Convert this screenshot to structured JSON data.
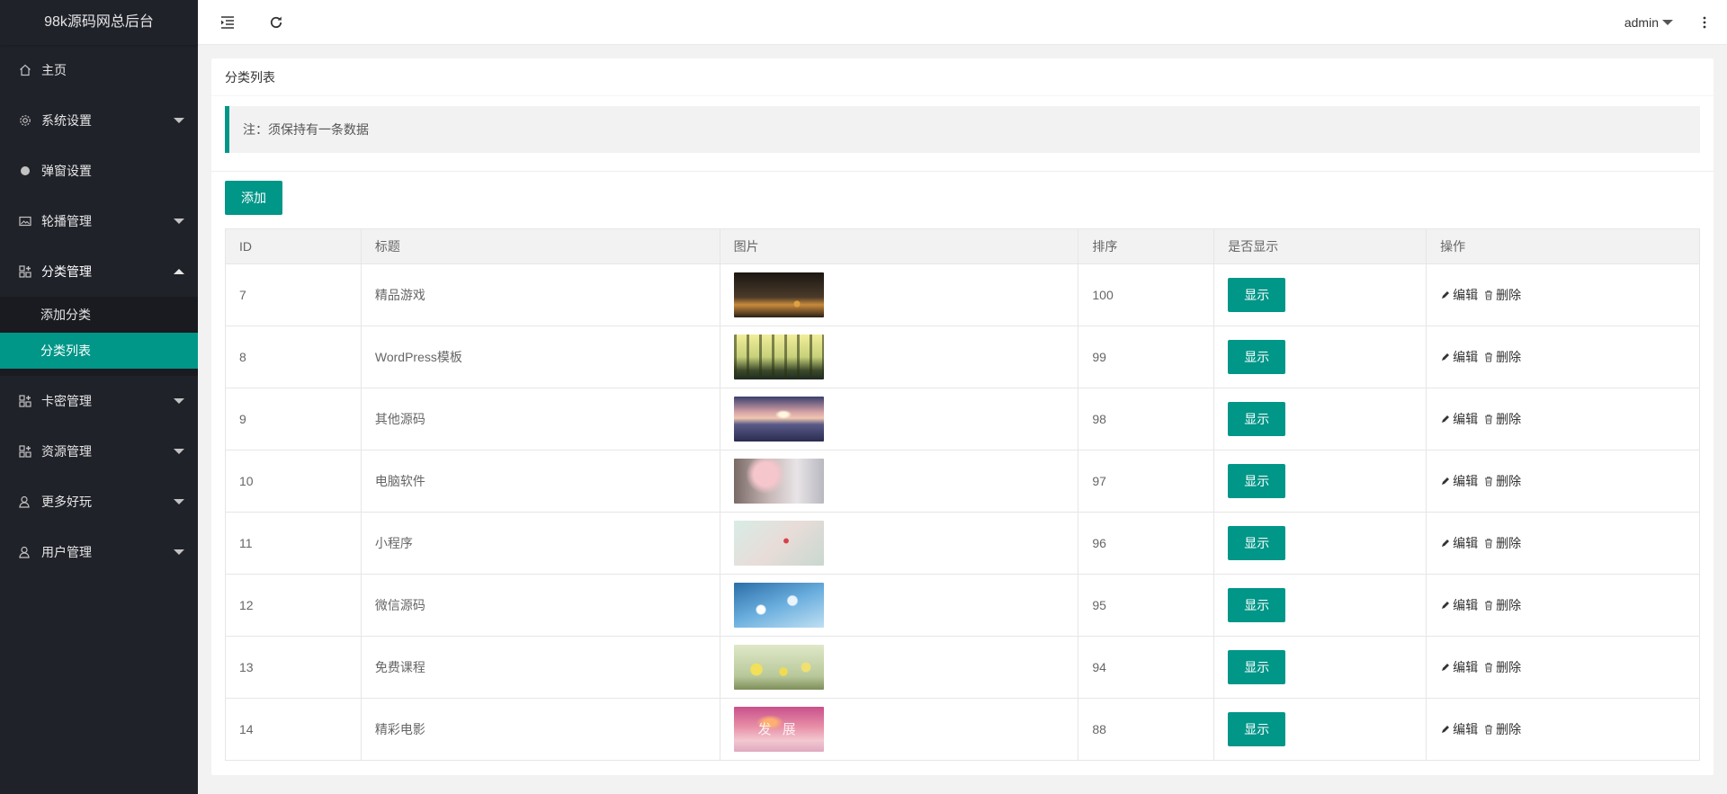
{
  "app": {
    "title": "98k源码网总后台"
  },
  "sidebar": {
    "items": [
      {
        "label": "主页",
        "icon": "home-icon",
        "has_arrow": false
      },
      {
        "label": "系统设置",
        "icon": "gear-icon",
        "has_arrow": true
      },
      {
        "label": "弹窗设置",
        "icon": "circle-icon",
        "has_arrow": false
      },
      {
        "label": "轮播管理",
        "icon": "image-icon",
        "has_arrow": true
      },
      {
        "label": "分类管理",
        "icon": "app-grid-icon",
        "has_arrow": true,
        "open": true
      },
      {
        "label": "卡密管理",
        "icon": "app-grid-icon",
        "has_arrow": true
      },
      {
        "label": "资源管理",
        "icon": "app-grid-icon",
        "has_arrow": true
      },
      {
        "label": "更多好玩",
        "icon": "user-icon",
        "has_arrow": true
      },
      {
        "label": "用户管理",
        "icon": "user-icon",
        "has_arrow": true
      }
    ],
    "sub_items": [
      {
        "label": "添加分类",
        "active": false
      },
      {
        "label": "分类列表",
        "active": true
      }
    ]
  },
  "header": {
    "user": "admin",
    "menu_toggle_icon": "indent-icon",
    "refresh_icon": "refresh-icon",
    "more_icon": "more-vertical-icon"
  },
  "card": {
    "title": "分类列表",
    "note": "注：须保持有一条数据",
    "add_label": "添加"
  },
  "table": {
    "columns": [
      "ID",
      "标题",
      "图片",
      "排序",
      "是否显示",
      "操作"
    ],
    "rows": [
      {
        "id": "7",
        "title": "精品游戏",
        "sort": "100",
        "show": "显示",
        "edit": "编辑",
        "del": "删除",
        "img": "dusk-trees"
      },
      {
        "id": "8",
        "title": "WordPress模板",
        "sort": "99",
        "show": "显示",
        "edit": "编辑",
        "del": "删除",
        "img": "yellow-forest"
      },
      {
        "id": "9",
        "title": "其他源码",
        "sort": "98",
        "show": "显示",
        "edit": "编辑",
        "del": "删除",
        "img": "sunset-lake"
      },
      {
        "id": "10",
        "title": "电脑软件",
        "sort": "97",
        "show": "显示",
        "edit": "编辑",
        "del": "删除",
        "img": "blossom-tree"
      },
      {
        "id": "11",
        "title": "小程序",
        "sort": "96",
        "show": "显示",
        "edit": "编辑",
        "del": "删除",
        "img": "pastel-heart"
      },
      {
        "id": "12",
        "title": "微信源码",
        "sort": "95",
        "show": "显示",
        "edit": "编辑",
        "del": "删除",
        "img": "blue-flowers"
      },
      {
        "id": "13",
        "title": "免费课程",
        "sort": "94",
        "show": "显示",
        "edit": "编辑",
        "del": "删除",
        "img": "daisy-field"
      },
      {
        "id": "14",
        "title": "精彩电影",
        "sort": "88",
        "show": "显示",
        "edit": "编辑",
        "del": "删除",
        "img": "pink-sunrise",
        "img_text": "发 展"
      }
    ]
  },
  "colors": {
    "accent": "#009688",
    "sidebar_bg": "#20222a"
  }
}
